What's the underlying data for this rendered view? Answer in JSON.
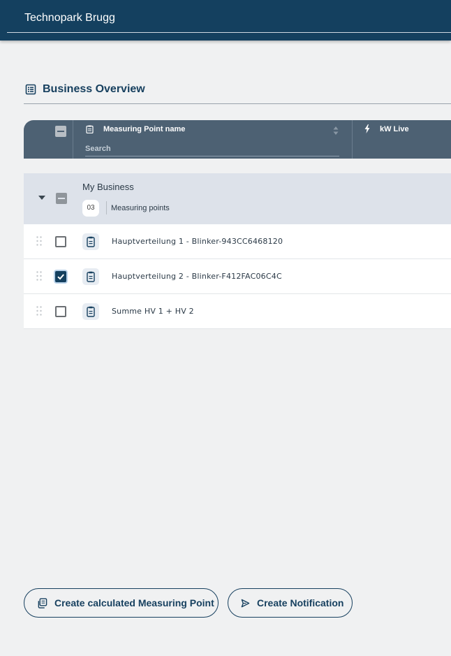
{
  "header": {
    "title": "Technopark Brugg"
  },
  "section": {
    "title": "Business Overview"
  },
  "table": {
    "columns": [
      {
        "label": "Measuring Point name",
        "search_placeholder": "Search"
      },
      {
        "label": "kW Live"
      }
    ]
  },
  "group": {
    "name": "My Business",
    "count": "03",
    "count_label": "Measuring points"
  },
  "rows": [
    {
      "name": "Hauptverteilung 1 - Blinker-943CC6468120",
      "checked": false
    },
    {
      "name": "Hauptverteilung 2 - Blinker-F412FAC06C4C",
      "checked": true
    },
    {
      "name": "Summe HV 1 + HV 2",
      "checked": false
    }
  ],
  "actions": {
    "create_calculated": "Create calculated Measuring Point",
    "create_notification": "Create Notification"
  },
  "colors": {
    "primary": "#14405f",
    "header_row": "#4d6173",
    "group_bg": "#dde2ea",
    "page_bg": "#f0f1f2"
  }
}
